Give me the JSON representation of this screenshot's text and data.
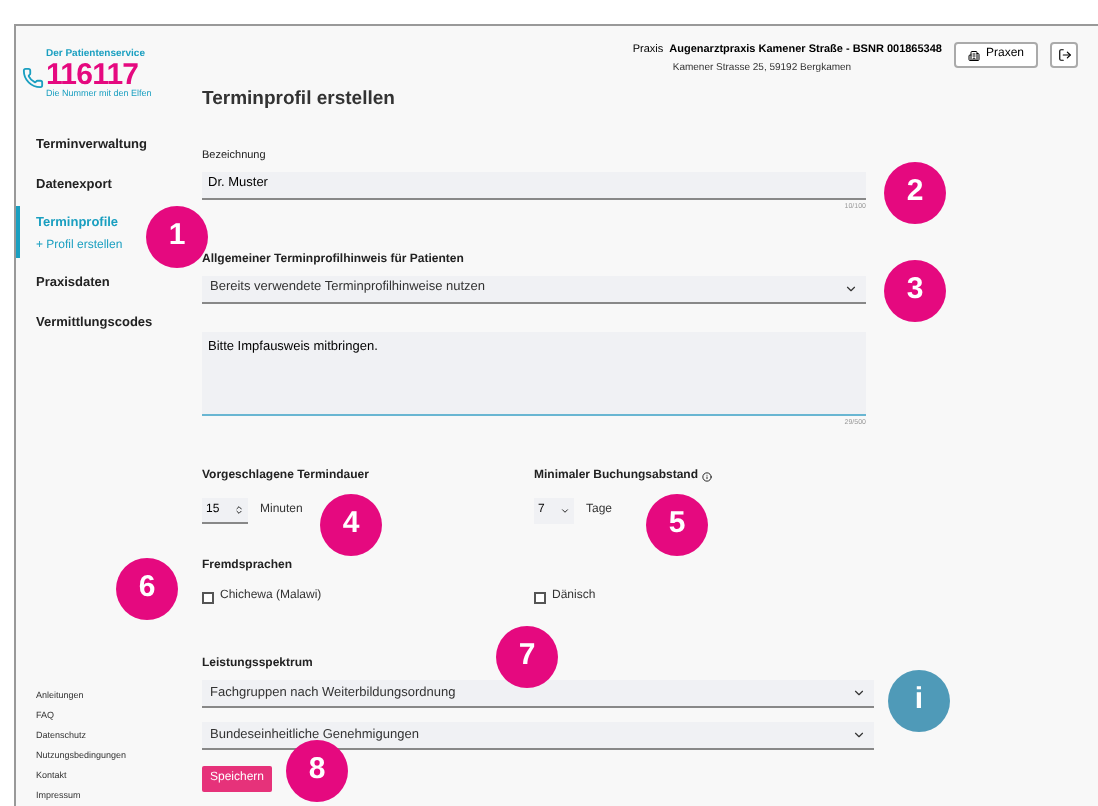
{
  "logo": {
    "tagline_top": "Der Patientenservice",
    "number": "116117",
    "tagline_bottom": "Die Nummer mit den Elfen"
  },
  "header": {
    "prefix": "Praxis",
    "practice": "Augenarztpraxis Kamener Straße - BSNR 001865348",
    "address": "Kamener Strasse 25, 59192 Bergkamen",
    "button": "Praxen"
  },
  "sidebar": {
    "items": [
      {
        "label": "Terminverwaltung",
        "selected": false
      },
      {
        "label": "Datenexport",
        "selected": false
      },
      {
        "label": "Terminprofile",
        "selected": true,
        "children": [
          {
            "label": "+ Profil erstellen",
            "selected": true
          }
        ]
      },
      {
        "label": "Praxisdaten",
        "selected": false
      },
      {
        "label": "Vermittlungscodes",
        "selected": false
      }
    ],
    "footer_links": [
      "Anleitungen",
      "FAQ",
      "Datenschutz",
      "Nutzungsbedingungen",
      "Kontakt",
      "Impressum"
    ]
  },
  "page_title": "Terminprofil erstellen",
  "bezeichnung": {
    "label": "Bezeichnung",
    "value": "Dr. Muster",
    "counter": "10/100"
  },
  "hinweis": {
    "label": "Allgemeiner Terminprofilhinweis für Patienten",
    "select": "Bereits verwendete Terminprofilhinweise nutzen",
    "text": "Bitte Impfausweis mitbringen.",
    "counter": "29/500"
  },
  "dauer": {
    "label": "Vorgeschlagene Termindauer",
    "value": "15",
    "unit": "Minuten"
  },
  "abstand": {
    "label": "Minimaler Buchungsabstand",
    "value": "7",
    "unit": "Tage"
  },
  "fremdsprachen": {
    "label": "Fremdsprachen",
    "options": [
      {
        "label": "Chichewa (Malawi)",
        "checked": false
      },
      {
        "label": "Dänisch",
        "checked": false
      }
    ]
  },
  "leistungsspektrum": {
    "label": "Leistungsspektrum",
    "selects": [
      "Fachgruppen nach Weiterbildungsordnung",
      "Bundeseinheitliche Genehmigungen"
    ]
  },
  "save_button": "Speichern",
  "callouts": [
    {
      "label": "1",
      "color": "#e5097f"
    },
    {
      "label": "2",
      "color": "#e5097f"
    },
    {
      "label": "3",
      "color": "#e5097f"
    },
    {
      "label": "4",
      "color": "#e5097f"
    },
    {
      "label": "5",
      "color": "#e5097f"
    },
    {
      "label": "6",
      "color": "#e5097f"
    },
    {
      "label": "7",
      "color": "#e5097f"
    },
    {
      "label": "i",
      "color": "#4f9ab8"
    },
    {
      "label": "8",
      "color": "#e5097f"
    }
  ]
}
